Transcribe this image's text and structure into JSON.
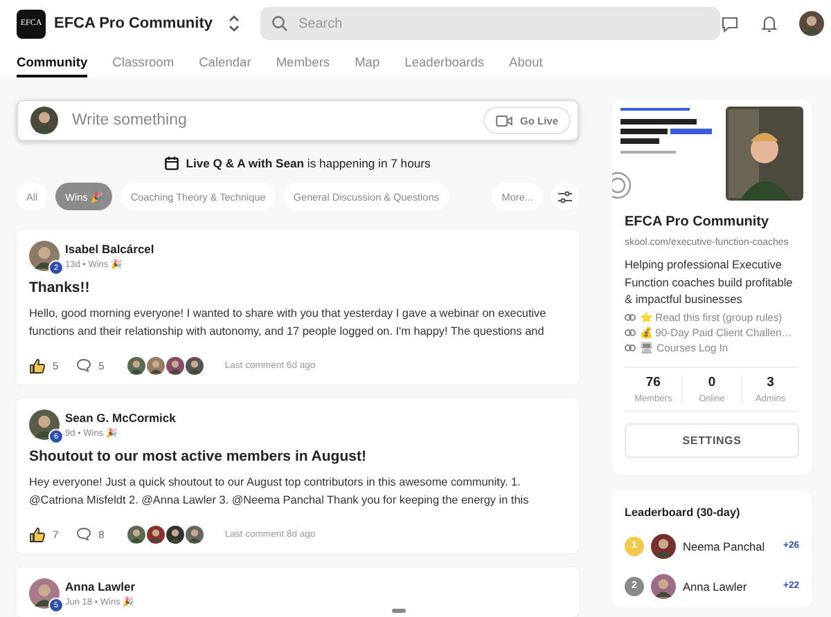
{
  "header": {
    "logo_text": "EFCA",
    "community_name": "EFCA Pro Community",
    "search": {
      "placeholder": "Search"
    }
  },
  "tabs": [
    {
      "label": "Community",
      "selected": true
    },
    {
      "label": "Classroom",
      "selected": false
    },
    {
      "label": "Calendar",
      "selected": false
    },
    {
      "label": "Members",
      "selected": false
    },
    {
      "label": "Map",
      "selected": false
    },
    {
      "label": "Leaderboards",
      "selected": false
    },
    {
      "label": "About",
      "selected": false
    }
  ],
  "composer": {
    "placeholder": "Write something",
    "go_live": "Go Live"
  },
  "event_banner": "**Live Q & A with Sean** is happening in 7 hours",
  "filters": [
    {
      "label": "All",
      "selected": false
    },
    {
      "label": "Wins 🎉",
      "selected": true
    },
    {
      "label": "Coaching Theory & Technique",
      "selected": false
    },
    {
      "label": "General Discussion & Questions",
      "selected": false
    }
  ],
  "more_filter": "More...",
  "posts": [
    {
      "author": "Isabel Balcárcel",
      "level": "2",
      "meta": "13d • Wins 🎉",
      "title": "Thanks!!",
      "body": "Hello, good morning everyone! I wanted to share with you that yesterday I gave a webinar on executive functions and their relationship with autonomy, and 17 people logged on. I'm happy! The questions and",
      "likes": "5",
      "comments": "5",
      "last_comment": "Last comment 6d ago"
    },
    {
      "author": "Sean G. McCormick",
      "level": "6",
      "meta": "9d • Wins 🎉",
      "title": "Shoutout to our most active members in August!",
      "body": "Hey everyone! Just a quick shoutout to our August top contributors in this awesome community. 1. @Catriona Misfeldt 2. @Anna Lawler 3. @Neema Panchal Thank you for keeping the energy in this",
      "likes": "7",
      "comments": "8",
      "last_comment": "Last comment 8d ago"
    },
    {
      "author": "Anna Lawler",
      "level": "5",
      "meta": "Jun 18 • Wins 🎉"
    }
  ],
  "about": {
    "cover": {
      "kind": "picture"
    },
    "name": "EFCA Pro Community",
    "url": "skool.com/executive-function-coaches",
    "description": "Helping professional Executive Function coaches build profitable & impactful businesses",
    "links": [
      "⭐ Read this first (group rules)",
      "💰 90-Day Paid Client Challen…",
      "🖥 Courses Log In"
    ],
    "stats": [
      {
        "value": "76",
        "label": "Members"
      },
      {
        "value": "0",
        "label": "Online"
      },
      {
        "value": "3",
        "label": "Admins"
      }
    ],
    "settings_button": "SETTINGS"
  },
  "leaderboard": {
    "title": "Leaderboard (30-day)",
    "entries": [
      {
        "rank": "1",
        "name": "Neema Panchal",
        "points": "+26",
        "color": "#f2c94c"
      },
      {
        "rank": "2",
        "name": "Anna Lawler",
        "points": "+22",
        "color": "#8a8a8a"
      }
    ]
  }
}
